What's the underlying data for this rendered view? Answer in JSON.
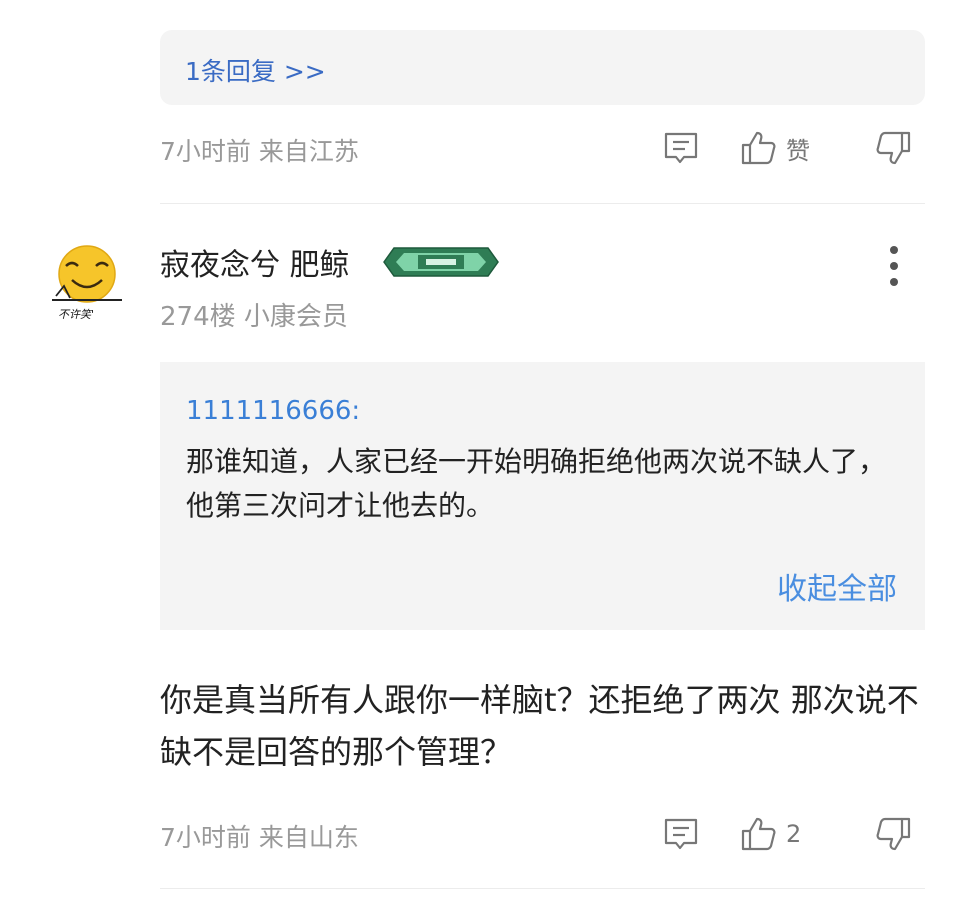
{
  "prev_comment": {
    "reply_link": "1条回复 >>",
    "meta": "7小时前 来自江苏",
    "like_label": "赞"
  },
  "comment": {
    "username": "寂夜念兮 肥鲸",
    "avatar_caption": "不许笑'",
    "floor_info": "274楼 小康会员",
    "quote": {
      "user": "1111116666:",
      "text": "那谁知道，人家已经一开始明确拒绝他两次说不缺人了，他第三次问才让他去的。",
      "collapse_label": "收起全部"
    },
    "text": "你是真当所有人跟你一样脑t？还拒绝了两次 那次说不缺不是回答的那个管理？",
    "meta": "7小时前 来自山东",
    "like_count": "2"
  },
  "icons": {
    "comment": "comment-icon",
    "like": "thumbs-up-icon",
    "dislike": "thumbs-down-icon",
    "more": "more-vertical-icon"
  },
  "colors": {
    "link_blue": "#3a6bc4",
    "badge_green": "#2f7d55",
    "box_bg": "#f4f4f4"
  }
}
